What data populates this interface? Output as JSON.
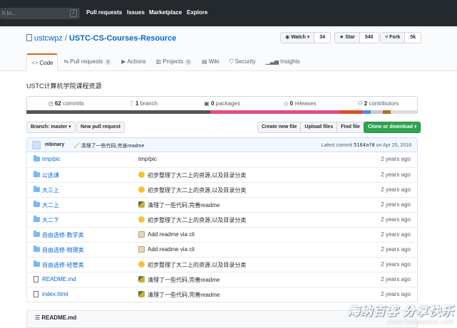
{
  "header": {
    "search_placeholder": "h to...",
    "slash_key": "/",
    "nav": [
      "Pull requests",
      "Issues",
      "Marketplace",
      "Explore"
    ]
  },
  "repo": {
    "owner": "ustcwpz",
    "separator": "/",
    "name": "USTC-CS-Courses-Resource",
    "watch_label": "Watch ▾",
    "watch_count": "34",
    "star_label": "Star",
    "star_count": "540",
    "fork_label": "Fork",
    "fork_count": "5k"
  },
  "tabs": [
    {
      "label": "Code",
      "icon": "code-icon"
    },
    {
      "label": "Pull requests",
      "counter": "0",
      "icon": "pull-request-icon"
    },
    {
      "label": "Actions",
      "icon": "play-icon"
    },
    {
      "label": "Projects",
      "counter": "0",
      "icon": "project-icon"
    },
    {
      "label": "Wiki",
      "icon": "book-icon"
    },
    {
      "label": "Security",
      "icon": "shield-icon"
    },
    {
      "label": "Insights",
      "icon": "graph-icon"
    }
  ],
  "description": "USTC计算机学院课程资源",
  "summary": {
    "commits_num": "62",
    "commits_label": "commits",
    "branch_num": "1",
    "branch_label": "branch",
    "packages_num": "0",
    "packages_label": "packages",
    "releases_num": "0",
    "releases_label": "releases",
    "contributors_num": "2",
    "contributors_label": "contributors"
  },
  "language_bar": [
    {
      "color": "#555555",
      "share": 47
    },
    {
      "color": "#e44b82",
      "share": 33
    },
    {
      "color": "#e34c26",
      "share": 6
    },
    {
      "color": "#438eff",
      "share": 2
    },
    {
      "color": "#c9c9c9",
      "share": 3
    },
    {
      "color": "#b07219",
      "share": 2
    },
    {
      "color": "#dddddd",
      "share": 7
    }
  ],
  "toolbar": {
    "branch": "Branch: master ▾",
    "new_pr": "New pull request",
    "create_file": "Create new file",
    "upload_files": "Upload files",
    "find_file": "Find file",
    "clone": "Clone or download ▾"
  },
  "latest_commit": {
    "author": "mbinary",
    "message": "清理了一些代码,完善readme",
    "prefix": "Latest commit",
    "sha": "5164af8",
    "date": "on Apr 25, 2018"
  },
  "files": [
    {
      "name": "tmp/pic",
      "type": "dir",
      "emoji": "none",
      "message": "tmp/pic",
      "age": "2 years ago"
    },
    {
      "name": "公选课",
      "type": "dir",
      "emoji": "smile",
      "message": "初步整理了大二上的资源,以及目录分类",
      "age": "2 years ago"
    },
    {
      "name": "大三上",
      "type": "dir",
      "emoji": "smile",
      "message": "初步整理了大二上的资源,以及目录分类",
      "age": "2 years ago"
    },
    {
      "name": "大二上",
      "type": "dir",
      "emoji": "broom",
      "message": "清理了一些代码,完善readme",
      "age": "2 years ago"
    },
    {
      "name": "大二下",
      "type": "dir",
      "emoji": "smile",
      "message": "初步整理了大二上的资源,以及目录分类",
      "age": "2 years ago"
    },
    {
      "name": "自由选修-数学类",
      "type": "dir",
      "emoji": "memo",
      "message": "Add readme via cli",
      "age": "2 years ago"
    },
    {
      "name": "自由选修-物理类",
      "type": "dir",
      "emoji": "memo",
      "message": "Add readme via cli",
      "age": "2 years ago"
    },
    {
      "name": "自由选修-经管类",
      "type": "dir",
      "emoji": "smile",
      "message": "初步整理了大二上的资源,以及目录分类",
      "age": "2 years ago"
    },
    {
      "name": "README.md",
      "type": "file",
      "emoji": "broom",
      "message": "清理了一些代码,完善readme",
      "age": "2 years ago"
    },
    {
      "name": "index.html",
      "type": "file",
      "emoji": "broom",
      "message": "清理了一些代码,完善readme",
      "age": "2 years ago"
    }
  ],
  "readme": {
    "label": "README.md"
  },
  "watermark": {
    "line1": "海纳百客 分享快乐",
    "line2": "www.hainabaike.com"
  }
}
